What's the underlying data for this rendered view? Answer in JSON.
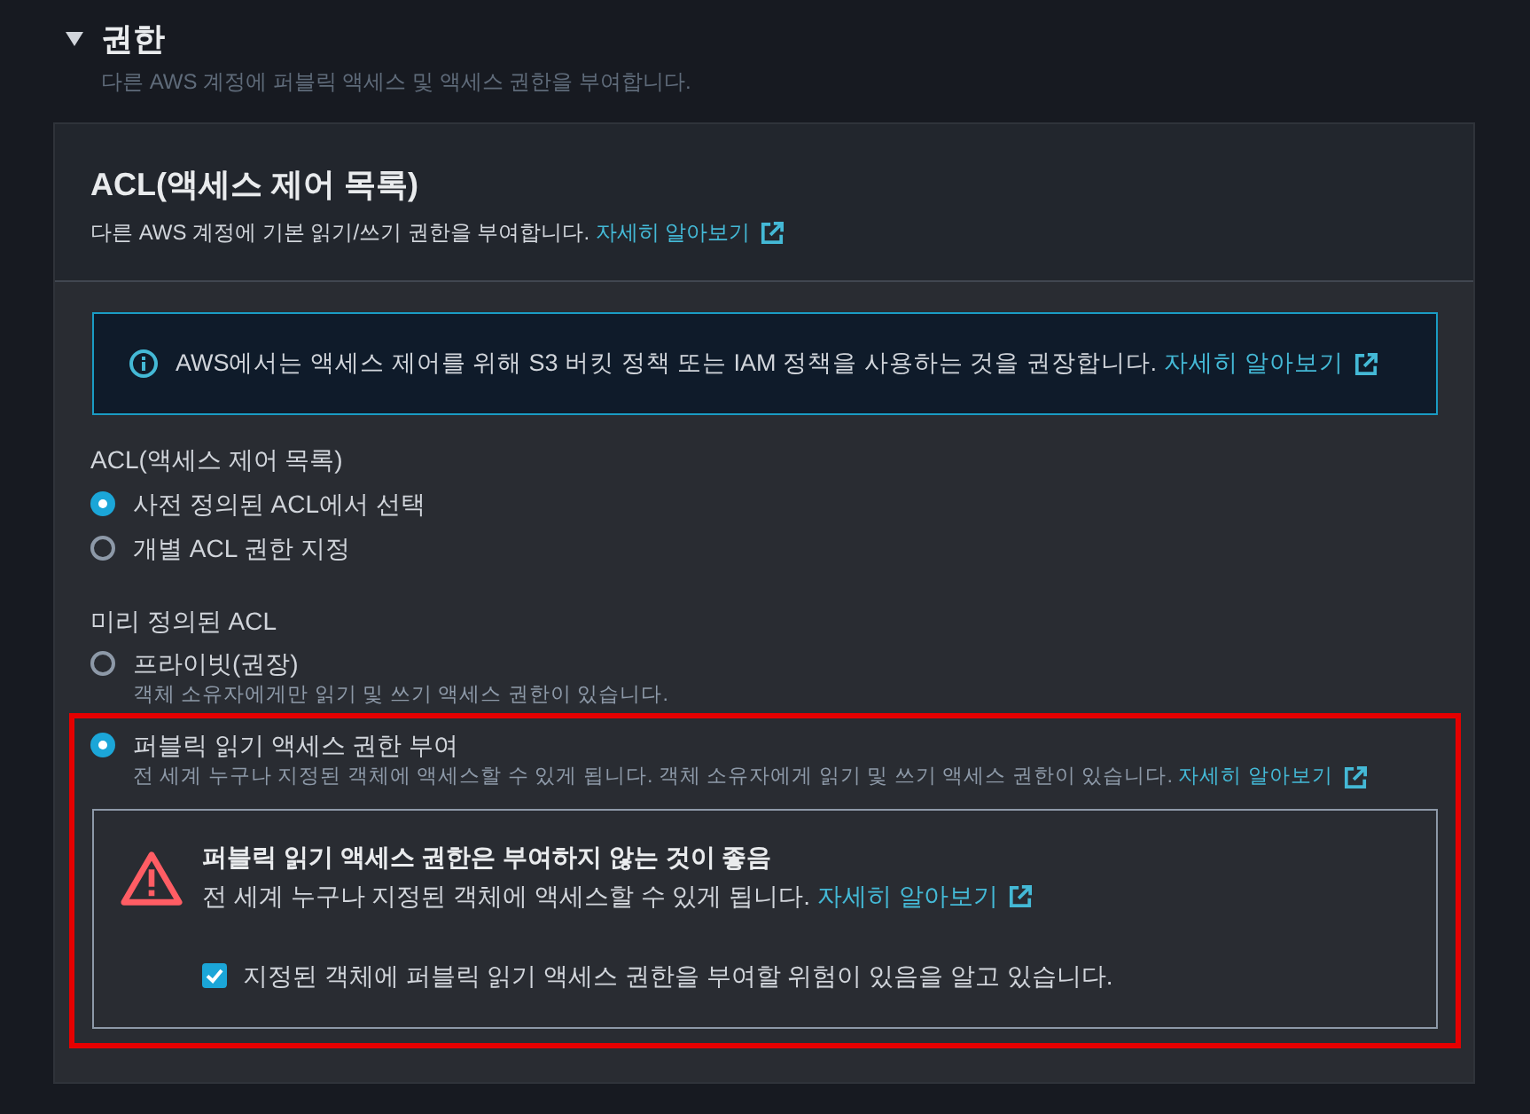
{
  "section": {
    "title": "권한",
    "expanded": true,
    "description": "다른 AWS 계정에 퍼블릭 액세스 및 액세스 권한을 부여합니다."
  },
  "panel": {
    "title": "ACL(액세스 제어 목록)",
    "description": "다른 AWS 계정에 기본 읽기/쓰기 권한을 부여합니다.",
    "link": "자세히 알아보기"
  },
  "info_alert": {
    "text": "AWS에서는 액세스 제어를 위해 S3 버킷 정책 또는 IAM 정책을 사용하는 것을 권장합니다.",
    "link": "자세히 알아보기"
  },
  "acl_mode": {
    "label": "ACL(액세스 제어 목록)",
    "options": [
      {
        "label": "사전 정의된 ACL에서 선택",
        "selected": true
      },
      {
        "label": "개별 ACL 권한 지정",
        "selected": false
      }
    ]
  },
  "predefined_acl": {
    "label": "미리 정의된 ACL",
    "options": [
      {
        "label": "프라이빗(권장)",
        "description": "객체 소유자에게만 읽기 및 쓰기 액세스 권한이 있습니다.",
        "selected": false
      },
      {
        "label": "퍼블릭 읽기 액세스 권한 부여",
        "description": "전 세계 누구나 지정된 객체에 액세스할 수 있게 됩니다. 객체 소유자에게 읽기 및 쓰기 액세스 권한이 있습니다.",
        "link": "자세히 알아보기",
        "selected": true,
        "highlighted": true,
        "warning": {
          "title": "퍼블릭 읽기 액세스 권한은 부여하지 않는 것이 좋음",
          "text": "전 세계 누구나 지정된 객체에 액세스할 수 있게 됩니다.",
          "link": "자세히 알아보기",
          "acknowledge": {
            "label": "지정된 객체에 퍼블릭 읽기 액세스 권한을 부여할 위험이 있음을 알고 있습니다.",
            "checked": true
          }
        }
      }
    ]
  }
}
